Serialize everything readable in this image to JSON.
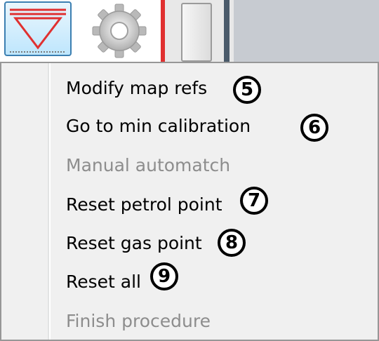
{
  "toolbar": {
    "buttons": [
      {
        "icon": "triangle-filter-icon",
        "state": "selected"
      },
      {
        "icon": "gear-icon",
        "state": "normal"
      }
    ]
  },
  "context_menu": {
    "items": [
      {
        "label": "Modify map refs",
        "enabled": true,
        "badge": "5"
      },
      {
        "label": "Go to min calibration",
        "enabled": true,
        "badge": "6"
      },
      {
        "label": "Manual automatch",
        "enabled": false,
        "badge": ""
      },
      {
        "label": "Reset petrol point",
        "enabled": true,
        "badge": "7"
      },
      {
        "label": "Reset gas point",
        "enabled": true,
        "badge": "8"
      },
      {
        "label": "Reset all",
        "enabled": true,
        "badge": "9"
      },
      {
        "label": "Finish procedure",
        "enabled": false,
        "badge": ""
      }
    ]
  },
  "colors": {
    "accent_red": "#e03030",
    "selected_border": "#3c7fb1",
    "disabled_text": "#8d8d8d",
    "menu_background": "#f0f0f0"
  }
}
